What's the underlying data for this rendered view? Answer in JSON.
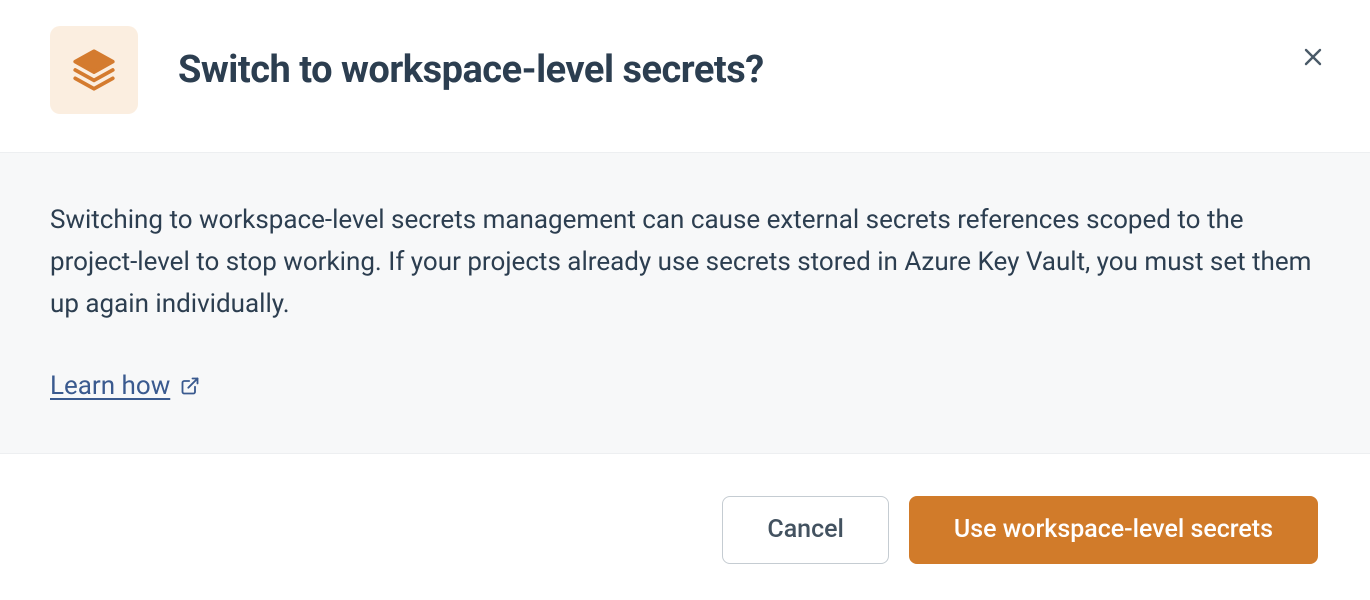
{
  "dialog": {
    "title": "Switch to workspace-level secrets?",
    "body_text": "Switching to workspace-level secrets management can cause external secrets references scoped to the project-level to stop working. If your projects already use secrets stored in Azure Key Vault, you must set them up again individually.",
    "learn_link_label": "Learn how",
    "cancel_label": "Cancel",
    "confirm_label": "Use workspace-level secrets"
  }
}
